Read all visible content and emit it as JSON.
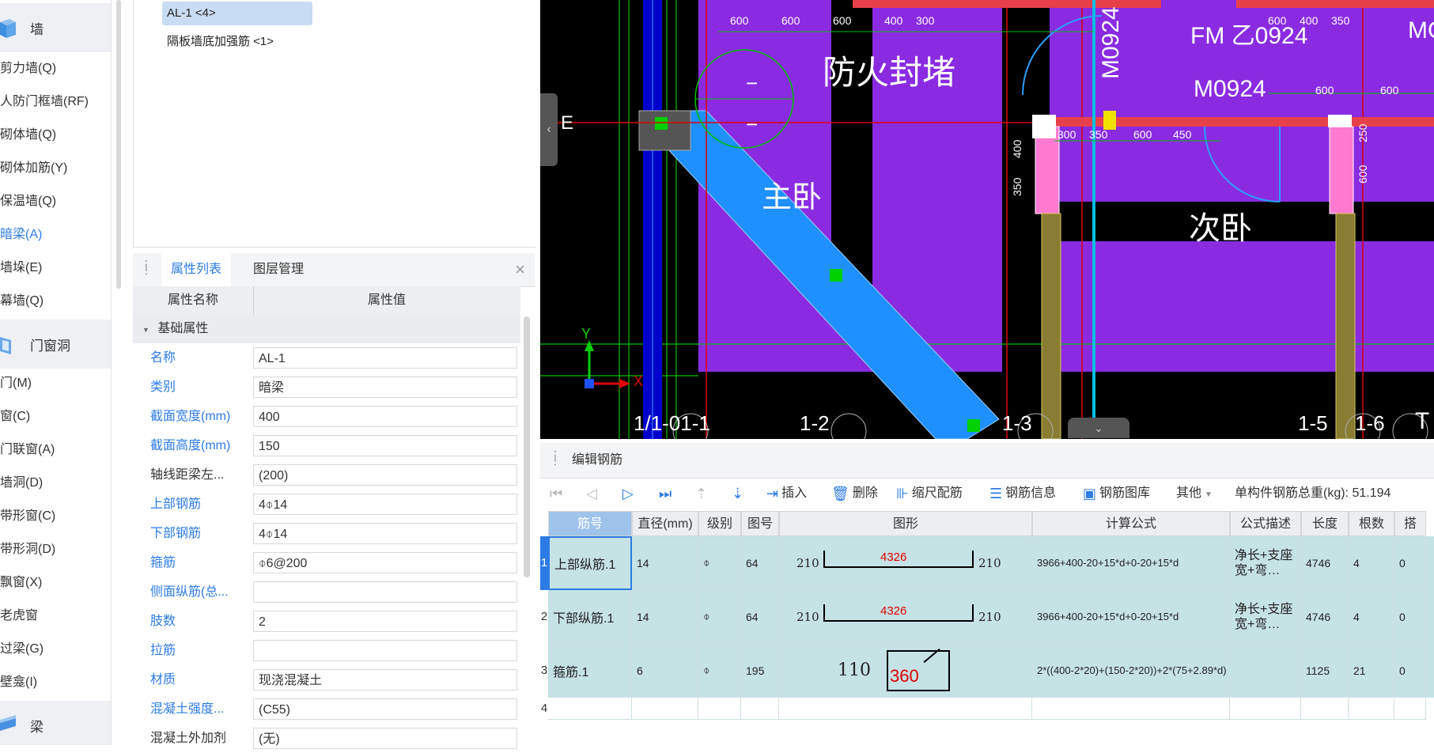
{
  "nav": {
    "categories": {
      "wall": "墙",
      "door_window": "门窗洞",
      "beam": "梁"
    },
    "wall_items": [
      "剪力墙(Q)",
      "人防门框墙(RF)",
      "砌体墙(Q)",
      "砌体加筋(Y)",
      "保温墙(Q)",
      "暗梁(A)",
      "墙垛(E)",
      "幕墙(Q)"
    ],
    "door_window_items": [
      "门(M)",
      "窗(C)",
      "门联窗(A)",
      "墙洞(D)",
      "带形窗(C)",
      "带形洞(D)",
      "飘窗(X)",
      "老虎窗",
      "过梁(G)",
      "壁龛(I)"
    ],
    "active_item": "暗梁(A)"
  },
  "tree": {
    "items": [
      "AL-1 <4>",
      "隔板墙底加强筋 <1>"
    ],
    "selected": "AL-1 <4>"
  },
  "properties": {
    "tabs": [
      "属性列表",
      "图层管理"
    ],
    "close": "×",
    "header": {
      "name": "属性名称",
      "value": "属性值"
    },
    "group": "基础属性",
    "group_toggle": "▼",
    "rows": [
      {
        "name": "名称",
        "value": "AL-1"
      },
      {
        "name": "类别",
        "value": "暗梁"
      },
      {
        "name": "截面宽度(mm)",
        "value": "400"
      },
      {
        "name": "截面高度(mm)",
        "value": "150"
      },
      {
        "name": "轴线距梁左...",
        "value": "(200)"
      },
      {
        "name": "上部钢筋",
        "value": "4⌽14"
      },
      {
        "name": "下部钢筋",
        "value": "4⌽14"
      },
      {
        "name": "箍筋",
        "value": "⌽6@200"
      },
      {
        "name": "侧面纵筋(总...",
        "value": ""
      },
      {
        "name": "肢数",
        "value": "2"
      },
      {
        "name": "拉筋",
        "value": ""
      },
      {
        "name": "材质",
        "value": "现浇混凝土"
      },
      {
        "name": "混凝土强度...",
        "value": "(C55)"
      },
      {
        "name": "混凝土外加剂",
        "value": "(无)"
      }
    ]
  },
  "canvas": {
    "labels": {
      "fire_seal": "防火封堵",
      "master_bedroom": "主卧",
      "second_bedroom": "次卧",
      "door_m0924_a": "M0924",
      "door_m0924_b": "M0924",
      "fm_label": "FM 乙0924",
      "mo_cut": "MO",
      "axis_e": "E",
      "axis_1_1": "1/1-01-1",
      "axis_1_2": "1-2",
      "axis_1_3": "1-3",
      "axis_1_5": "1-5",
      "axis_1_6": "1-6",
      "axis_t": "T",
      "y_axis": "Y",
      "x_axis": "X",
      "minus_a": "−",
      "minus_b": "−"
    },
    "dims": {
      "top": [
        "600",
        "600",
        "600",
        "400",
        "300",
        "600",
        "400",
        "350"
      ],
      "mid": [
        "300",
        "350",
        "600",
        "450"
      ],
      "right_top": [
        "600",
        "600"
      ],
      "vert_left": [
        "400",
        "350"
      ],
      "vert_right": [
        "250",
        "600"
      ]
    }
  },
  "rebar": {
    "title": "编辑钢筋",
    "toolbar": {
      "insert": "插入",
      "delete": "删除",
      "scale": "缩尺配筋",
      "info": "钢筋信息",
      "library": "钢筋图库",
      "other": "其他",
      "total_weight": "单构件钢筋总重(kg): 51.194"
    },
    "columns": [
      "筋号",
      "直径(mm)",
      "级别",
      "图号",
      "图形",
      "计算公式",
      "公式描述",
      "长度",
      "根数",
      "搭"
    ],
    "rows": [
      {
        "no": "1",
        "name": "上部纵筋.1",
        "dia": "14",
        "grade": "⌽",
        "fig": "64",
        "shape_left": "210",
        "shape_mid": "4326",
        "shape_right": "210",
        "formula": "3966+400-20+15*d+0-20+15*d",
        "desc": "净长+支座宽+弯…",
        "length": "4746",
        "count": "4",
        "lap": "0"
      },
      {
        "no": "2",
        "name": "下部纵筋.1",
        "dia": "14",
        "grade": "⌽",
        "fig": "64",
        "shape_left": "210",
        "shape_mid": "4326",
        "shape_right": "210",
        "formula": "3966+400-20+15*d+0-20+15*d",
        "desc": "净长+支座宽+弯…",
        "length": "4746",
        "count": "4",
        "lap": "0"
      },
      {
        "no": "3",
        "name": "箍筋.1",
        "dia": "6",
        "grade": "⌽",
        "fig": "195",
        "shape_left": "110",
        "shape_mid": "360",
        "shape_right": "",
        "formula": "2*((400-2*20)+(150-2*20))+2*(75+2.89*d)",
        "desc": "",
        "length": "1125",
        "count": "21",
        "lap": "0"
      },
      {
        "no": "4",
        "name": "",
        "dia": "",
        "grade": "",
        "fig": "",
        "shape_left": "",
        "shape_mid": "",
        "shape_right": "",
        "formula": "",
        "desc": "",
        "length": "",
        "count": "",
        "lap": ""
      }
    ]
  },
  "colors": {
    "accent": "#2d7be5",
    "canvas_purple": "#8a2be2",
    "beam_blue": "#1e90ff",
    "row_bg": "#c5e2e5"
  }
}
